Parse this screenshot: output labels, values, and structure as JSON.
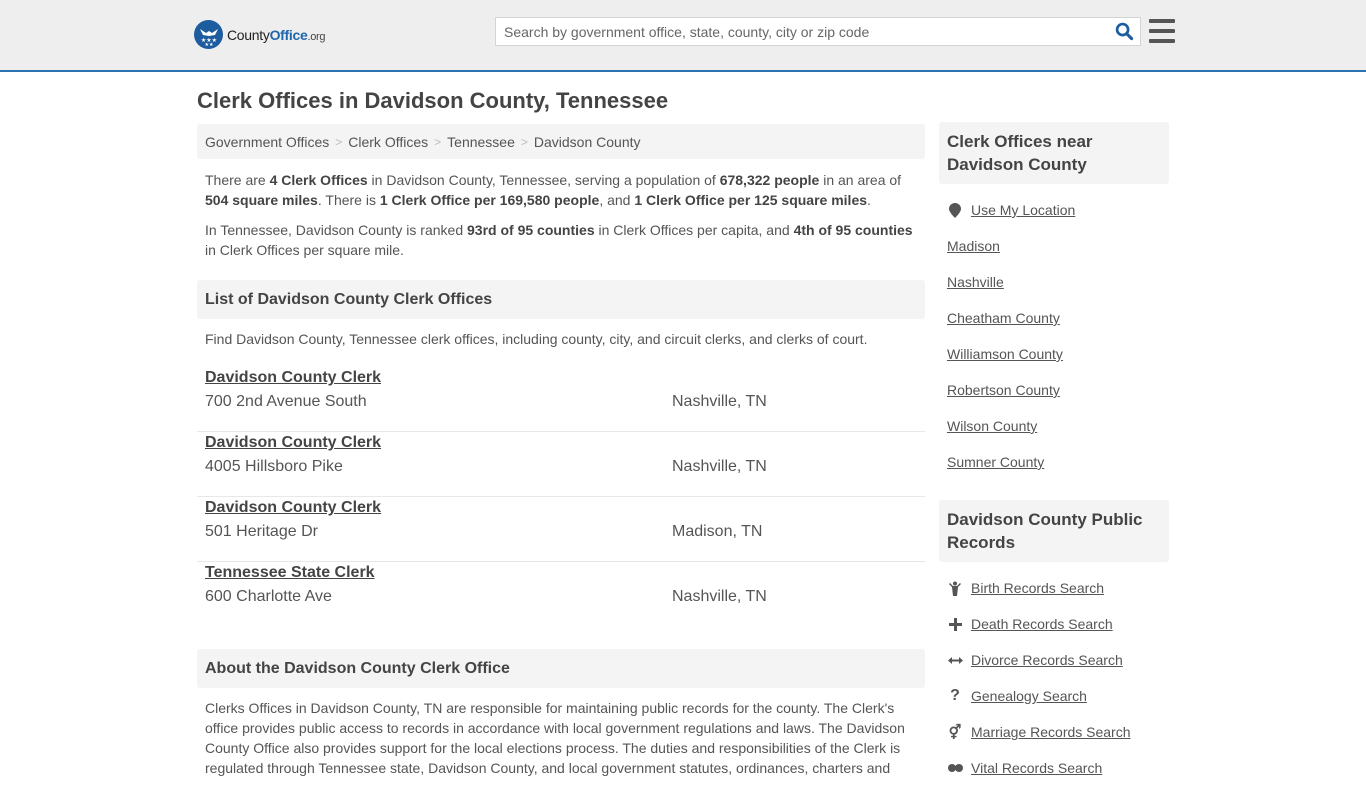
{
  "header": {
    "logo": {
      "name_part1": "County",
      "name_part2": "Office",
      "tld": ".org"
    },
    "search": {
      "placeholder": "Search by government office, state, county, city or zip code",
      "value": ""
    },
    "search_icon": "search-icon",
    "menu_icon": "hamburger-menu-icon"
  },
  "page_title": "Clerk Offices in Davidson County, Tennessee",
  "breadcrumb": [
    {
      "label": "Government Offices"
    },
    {
      "label": "Clerk Offices"
    },
    {
      "label": "Tennessee"
    },
    {
      "label": "Davidson County"
    }
  ],
  "summary": {
    "p1": {
      "t1": "There are ",
      "b1": "4 Clerk Offices",
      "t2": " in Davidson County, Tennessee, serving a population of ",
      "b2": "678,322 people",
      "t3": " in an area of ",
      "b3": "504 square miles",
      "t4": ". There is ",
      "b4": "1 Clerk Office per 169,580 people",
      "t5": ", and ",
      "b5": "1 Clerk Office per 125 square miles",
      "t6": "."
    },
    "p2": {
      "t1": "In Tennessee, Davidson County is ranked ",
      "b1": "93rd of 95 counties",
      "t2": " in Clerk Offices per capita, and ",
      "b2": "4th of 95 counties",
      "t3": " in Clerk Offices per square mile."
    }
  },
  "list_section": {
    "heading": "List of Davidson County Clerk Offices",
    "intro": "Find Davidson County, Tennessee clerk offices, including county, city, and circuit clerks, and clerks of court.",
    "offices": [
      {
        "name": "Davidson County Clerk",
        "address": "700 2nd Avenue South",
        "city": "Nashville, TN"
      },
      {
        "name": "Davidson County Clerk",
        "address": "4005 Hillsboro Pike",
        "city": "Nashville, TN"
      },
      {
        "name": "Davidson County Clerk",
        "address": "501 Heritage Dr",
        "city": "Madison, TN"
      },
      {
        "name": "Tennessee State Clerk",
        "address": "600 Charlotte Ave",
        "city": "Nashville, TN"
      }
    ]
  },
  "about_section": {
    "heading": "About the Davidson County Clerk Office",
    "text": "Clerks Offices in Davidson County, TN are responsible for maintaining public records for the county. The Clerk's office provides public access to records in accordance with local government regulations and laws. The Davidson County Office also provides support for the local elections process. The duties and responsibilities of the Clerk is regulated through Tennessee state, Davidson County, and local government statutes, ordinances, charters and"
  },
  "sidebar": {
    "nearby": {
      "heading": "Clerk Offices near Davidson County",
      "use_location": {
        "label": "Use My Location",
        "icon": "map-marker-icon"
      },
      "items": [
        {
          "label": "Madison"
        },
        {
          "label": "Nashville"
        },
        {
          "label": "Cheatham County"
        },
        {
          "label": "Williamson County"
        },
        {
          "label": "Robertson County"
        },
        {
          "label": "Wilson County"
        },
        {
          "label": "Sumner County"
        }
      ]
    },
    "records": {
      "heading": "Davidson County Public Records",
      "items": [
        {
          "label": "Birth Records Search",
          "icon": "child-icon"
        },
        {
          "label": "Death Records Search",
          "icon": "cross-icon"
        },
        {
          "label": "Divorce Records Search",
          "icon": "arrows-horizontal-icon"
        },
        {
          "label": "Genealogy Search",
          "icon": "question-icon"
        },
        {
          "label": "Marriage Records Search",
          "icon": "venus-mars-icon"
        },
        {
          "label": "Vital Records Search",
          "icon": "vital-icon"
        }
      ]
    }
  },
  "colors": {
    "accent": "#2b72b0",
    "logo_blue": "#1d5c9e",
    "header_bg": "#eeeeee",
    "panel_bg": "#f4f4f4",
    "text": "#555555"
  }
}
